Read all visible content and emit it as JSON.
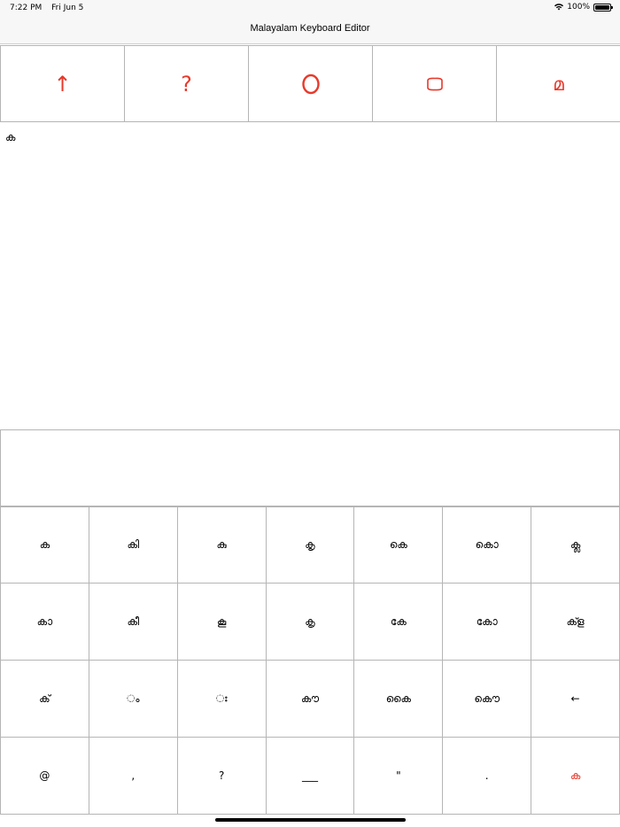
{
  "status": {
    "time": "7:22 PM",
    "date": "Fri Jun 5",
    "battery": "100%"
  },
  "nav": {
    "title": "Malayalam Keyboard Editor"
  },
  "toolbar": {
    "buttons": [
      {
        "label": "↑",
        "icon": "arrow-up-icon"
      },
      {
        "label": "?",
        "icon": "help-icon"
      },
      {
        "label": "O",
        "icon": "circle-icon"
      },
      {
        "label": "▭",
        "icon": "rounded-rect-icon"
      },
      {
        "label": "മ",
        "icon": "malayalam-ma-icon"
      }
    ]
  },
  "editor": {
    "text": "ക"
  },
  "keyboard": {
    "rows": [
      [
        "ക",
        "കി",
        "കു",
        "കൃ",
        "കെ",
        "കൊ",
        "ക്ല"
      ],
      [
        "കാ",
        "കീ",
        "കൂ",
        "കൄ",
        "കേ",
        "കോ",
        "ക്ള"
      ],
      [
        "ക്",
        "ം",
        "ഃ",
        "കൗ",
        "കൈ",
        "കൌ",
        "←"
      ],
      [
        "@",
        ",",
        "?",
        "___",
        "\"",
        ".",
        "ക"
      ]
    ],
    "accent_color": "#e8392b"
  }
}
